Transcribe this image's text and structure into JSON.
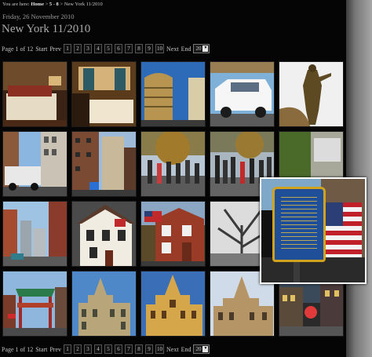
{
  "breadcrumb": {
    "prefix": "You are here:",
    "home": "Home",
    "sep1": ">",
    "level1": "5",
    "sep2": "-",
    "level2": "8",
    "sep3": ">",
    "current": "New York 11/2010"
  },
  "date": "Friday, 26 November 2010",
  "title": "New York 11/2010",
  "pagination": {
    "page_info": "Page 1 of 12",
    "start": "Start",
    "prev": "Prev",
    "pages": [
      "1",
      "2",
      "3",
      "4",
      "5",
      "6",
      "7",
      "8",
      "9",
      "10"
    ],
    "next": "Next",
    "end": "End",
    "per_page": "20"
  },
  "colors": {
    "background": "#050505",
    "magnifier_border": "#ffffff"
  },
  "thumbnails": [
    {
      "name": "hotel-room-bed"
    },
    {
      "name": "hotel-room-window"
    },
    {
      "name": "curved-tower-building"
    },
    {
      "name": "white-van"
    },
    {
      "name": "statue"
    },
    {
      "name": "truck-street"
    },
    {
      "name": "brick-street-buildings"
    },
    {
      "name": "crowd-under-tree"
    },
    {
      "name": "parade-crowd"
    },
    {
      "name": "flag-plaque-building"
    },
    {
      "name": "street-skyscrapers"
    },
    {
      "name": "historic-house-flag"
    },
    {
      "name": "brick-house-flag"
    },
    {
      "name": "bare-tree-bw"
    },
    {
      "name": "skyline-view"
    },
    {
      "name": "chinatown-gate"
    },
    {
      "name": "city-hall-a"
    },
    {
      "name": "city-hall-b"
    },
    {
      "name": "city-hall-c"
    },
    {
      "name": "neon-street"
    }
  ],
  "magnifier": {
    "name": "betsy-ross-plaque-zoom"
  }
}
